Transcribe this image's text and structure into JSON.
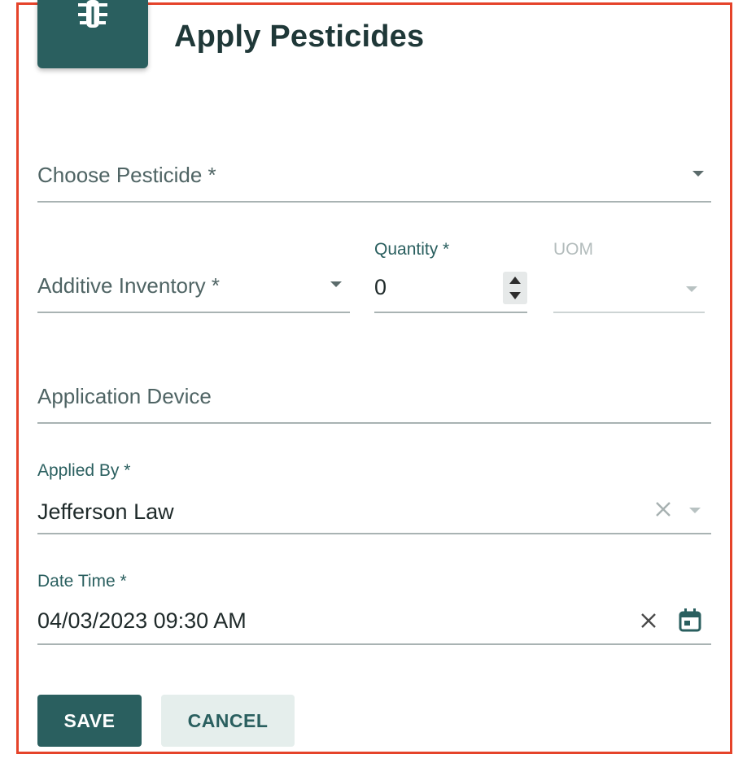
{
  "dialog": {
    "title": "Apply Pesticides",
    "header_icon": "bug-icon",
    "accent_color": "#2a5f5f",
    "highlight_border_color": "#e5432a"
  },
  "fields": {
    "pesticide": {
      "placeholder": "Choose Pesticide *"
    },
    "additive_inventory": {
      "placeholder": "Additive Inventory *"
    },
    "quantity": {
      "label": "Quantity *",
      "value": "0"
    },
    "uom": {
      "label": "UOM",
      "value": ""
    },
    "application_device": {
      "placeholder": "Application Device"
    },
    "applied_by": {
      "label": "Applied By *",
      "value": "Jefferson Law"
    },
    "date_time": {
      "label": "Date Time *",
      "value": "04/03/2023 09:30 AM"
    }
  },
  "actions": {
    "save_label": "SAVE",
    "cancel_label": "CANCEL"
  }
}
